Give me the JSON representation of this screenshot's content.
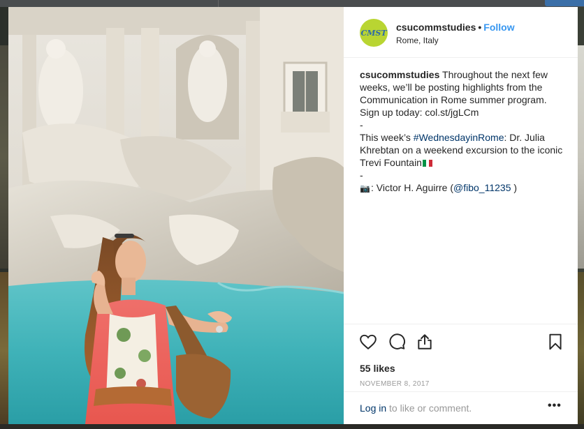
{
  "post": {
    "username": "csucommstudies",
    "follow_label": "Follow",
    "separator": "•",
    "location": "Rome, Italy",
    "avatar_text": "CMST",
    "caption": {
      "username": "csucommstudies",
      "line1_text": " Throughout the next few weeks, we’ll be posting highlights from the Communication in Rome summer program. Sign up today: col.st/jgLCm",
      "dash1": "-",
      "line2_prefix": "This week’s ",
      "hashtag": "#WednesdayinRome",
      "line2_text": ": Dr. Julia Khrebtan on a weekend excursion to the iconic Trevi Fountain",
      "flag_colors": [
        "#009246",
        "#ffffff",
        "#ce2b37"
      ],
      "dash2": "-",
      "credit_icon": "camera-emoji",
      "credit_glyph": "📷",
      "credit_prefix": ": Victor H. Aguirre (",
      "mention": "@fibo_11235",
      "credit_suffix": " )"
    },
    "likes": "55 likes",
    "date": "NOVEMBER 8, 2017",
    "login_link": "Log in",
    "login_text": " to like or comment.",
    "more_label": "•••"
  },
  "icons": {
    "like": "heart-icon",
    "comment": "comment-icon",
    "share": "share-icon",
    "save": "bookmark-icon",
    "more": "more-options-icon"
  },
  "colors": {
    "link": "#003569",
    "follow": "#3897f0",
    "avatar_bg": "#b9d532",
    "text": "#262626",
    "muted": "#999999"
  }
}
